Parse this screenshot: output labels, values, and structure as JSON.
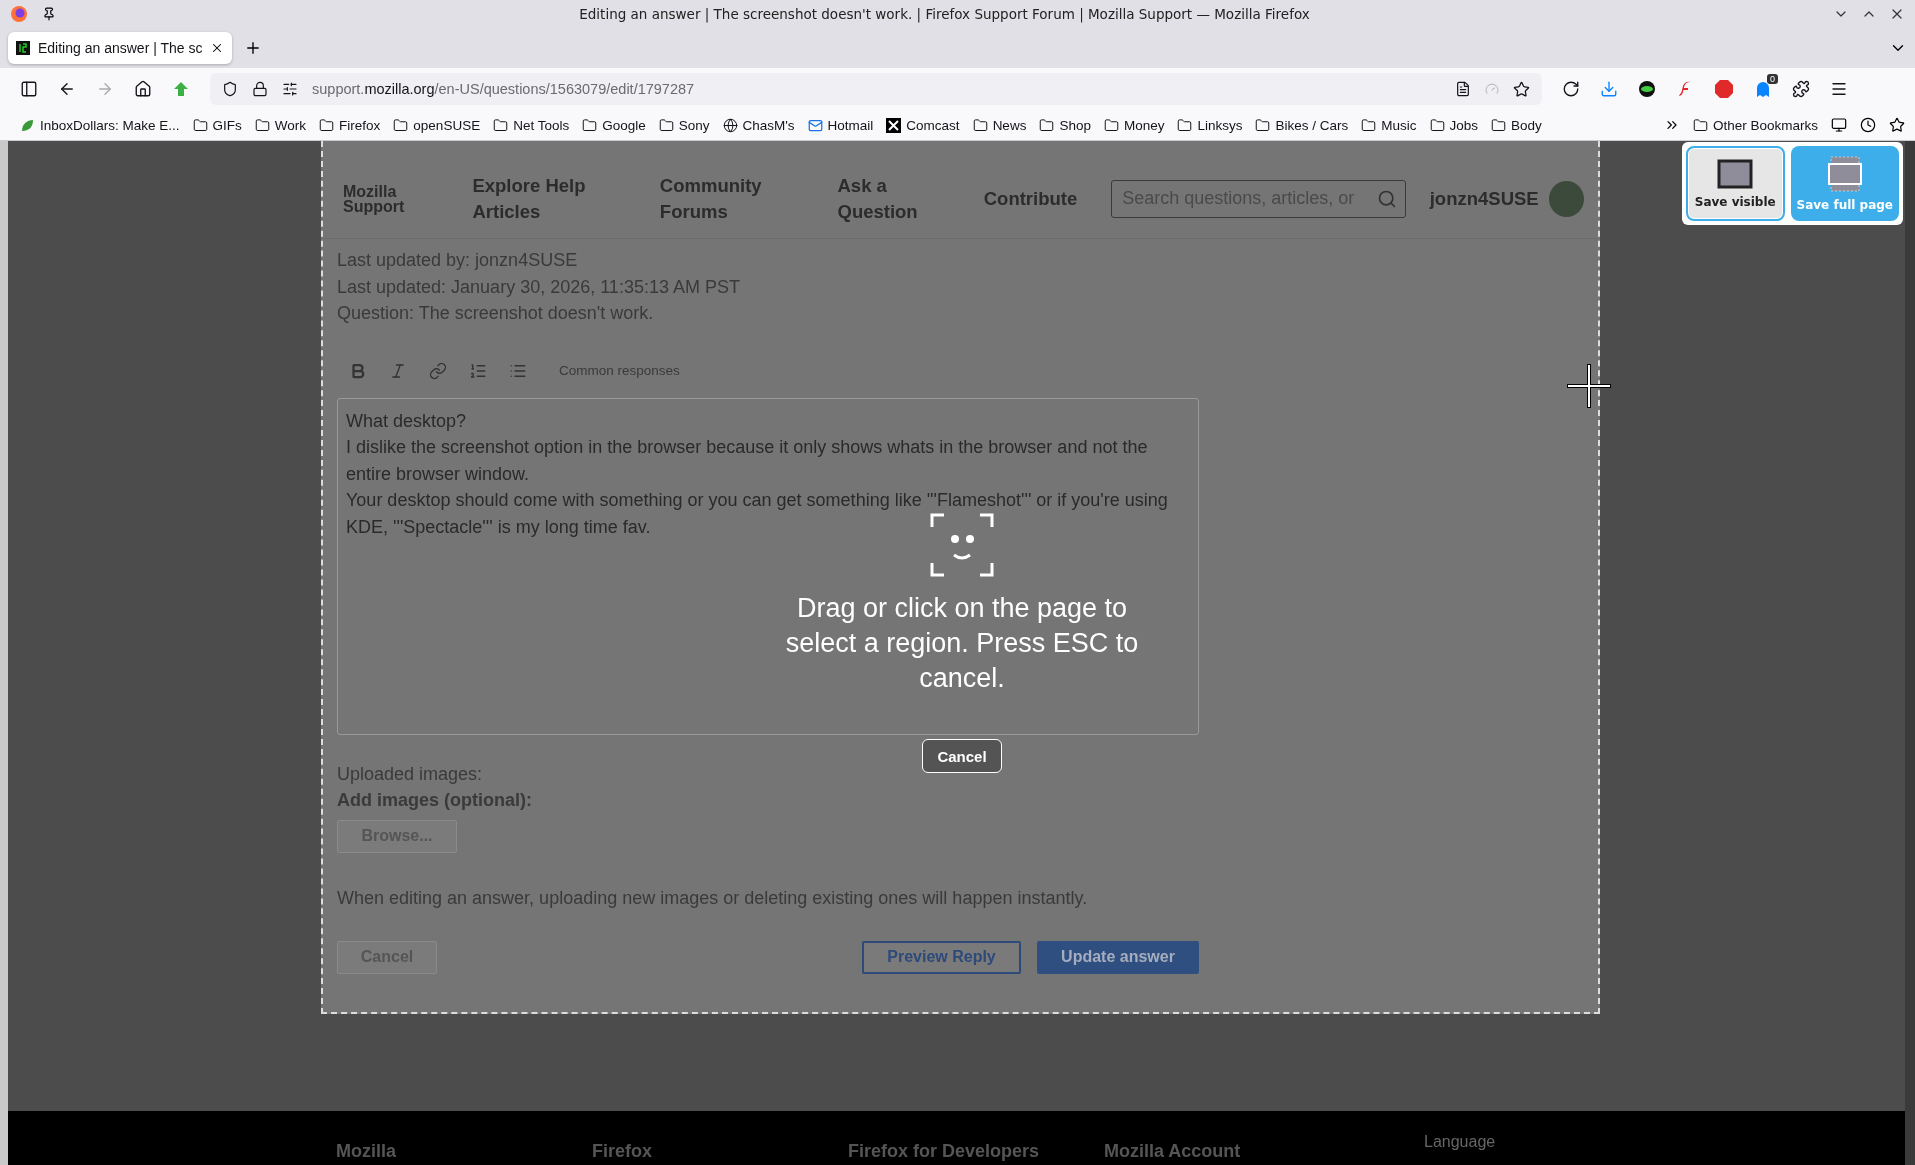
{
  "window": {
    "title": "Editing an answer | The screenshot doesn't work. | Firefox Support Forum | Mozilla Support — Mozilla Firefox"
  },
  "tabs": [
    {
      "label": "Editing an answer | The sc",
      "selected": true
    }
  ],
  "address_bar": {
    "host_prefix": "support.",
    "domain": "mozilla.org",
    "path": "/en-US/questions/1563079/edit/1797287"
  },
  "extension_badge": "0",
  "bookmarks": [
    {
      "label": "InboxDollars: Make E...",
      "kind": "site"
    },
    {
      "label": "GIFs",
      "kind": "folder"
    },
    {
      "label": "Work",
      "kind": "folder"
    },
    {
      "label": "Firefox",
      "kind": "folder"
    },
    {
      "label": "openSUSE",
      "kind": "folder"
    },
    {
      "label": "Net Tools",
      "kind": "folder"
    },
    {
      "label": "Google",
      "kind": "folder"
    },
    {
      "label": "Sony",
      "kind": "folder"
    },
    {
      "label": "ChasM's",
      "kind": "globe"
    },
    {
      "label": "Hotmail",
      "kind": "mail"
    },
    {
      "label": "Comcast",
      "kind": "x"
    },
    {
      "label": "News",
      "kind": "folder"
    },
    {
      "label": "Shop",
      "kind": "folder"
    },
    {
      "label": "Money",
      "kind": "folder"
    },
    {
      "label": "Linksys",
      "kind": "folder"
    },
    {
      "label": "Bikes / Cars",
      "kind": "folder"
    },
    {
      "label": "Music",
      "kind": "folder"
    },
    {
      "label": "Jobs",
      "kind": "folder"
    },
    {
      "label": "Body",
      "kind": "folder"
    }
  ],
  "other_bookmarks": "Other Bookmarks",
  "site": {
    "logo": "Mozilla Support",
    "nav": [
      "Explore Help Articles",
      "Community Forums",
      "Ask a Question",
      "Contribute"
    ],
    "search_placeholder": "Search questions, articles, or",
    "username": "jonzn4SUSE"
  },
  "meta": [
    "Last updated by: jonzn4SUSE",
    "Last updated: January 30, 2026, 11:35:13 AM PST",
    "Question: The screenshot doesn't work."
  ],
  "editor": {
    "toolbar_label": "Common responses",
    "value": "What desktop?\nI dislike the screenshot option in the browser because it only shows whats in the browser and not the entire browser window.\nYour desktop should come with something or you can get something like '''Flameshot''' or if you're using KDE, '''Spectacle''' is my long time fav."
  },
  "uploaded_label": "Uploaded images:",
  "add_images_label": "Add images (optional):",
  "browse_button": "Browse...",
  "note": "When editing an answer, uploading new images or deleting existing ones will happen instantly.",
  "form_buttons": [
    {
      "label": "Cancel",
      "kind": "plain"
    },
    {
      "label": "Preview Reply",
      "kind": "outline"
    },
    {
      "label": "Update answer",
      "kind": "primary"
    }
  ],
  "overlay": {
    "message": "Drag or click on the page to select a region. Press ESC to cancel.",
    "cancel": "Cancel"
  },
  "capture_options": [
    {
      "label": "Save visible",
      "kind": "visible",
      "focused": true
    },
    {
      "label": "Save full page",
      "kind": "full",
      "focused": false
    }
  ],
  "footer": {
    "columns": [
      "Mozilla",
      "Firefox",
      "Firefox for Developers",
      "Mozilla Account"
    ],
    "language": "Language"
  }
}
